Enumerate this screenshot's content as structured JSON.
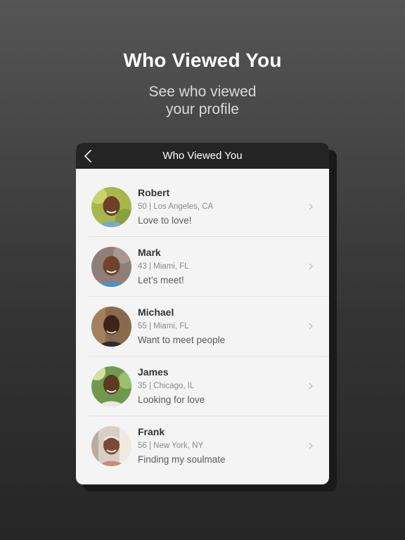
{
  "promo": {
    "title": "Who Viewed You",
    "subtitle_line1": "See who viewed",
    "subtitle_line2": "your profile"
  },
  "nav": {
    "title": "Who Viewed You",
    "back_icon": "chevron-left-icon"
  },
  "colors": {
    "nav_background": "#242424",
    "card_background": "#f4f4f4",
    "name_text": "#333333",
    "meta_text": "#8a8a8a"
  },
  "viewers": [
    {
      "name": "Robert",
      "meta": "50 | Los Angeles, CA",
      "tagline": "Love to love!"
    },
    {
      "name": "Mark",
      "meta": "43 | Miami, FL",
      "tagline": "Let’s meet!"
    },
    {
      "name": "Michael",
      "meta": "55 | Miami, FL",
      "tagline": "Want to meet people"
    },
    {
      "name": "James",
      "meta": "35 | Chicago, IL",
      "tagline": "Looking for love"
    },
    {
      "name": "Frank",
      "meta": "56 | New York, NY",
      "tagline": "Finding my soulmate"
    }
  ]
}
